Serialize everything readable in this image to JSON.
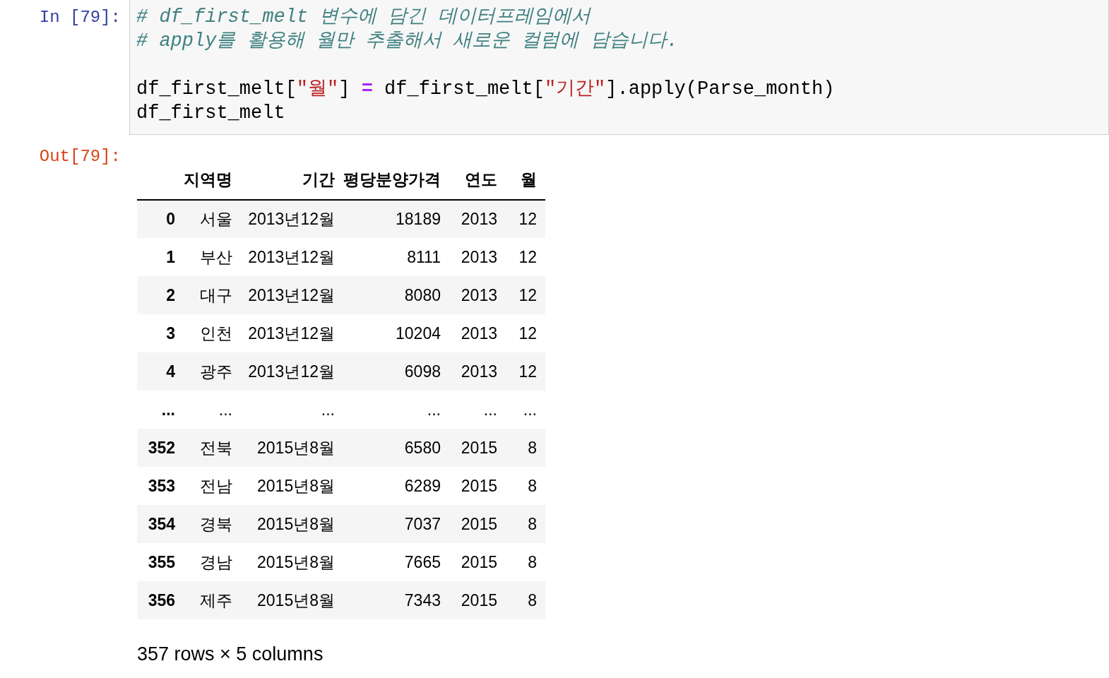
{
  "input_cell": {
    "prompt": "In [79]:",
    "lines": [
      {
        "blank_before": false,
        "tokens": [
          {
            "kind": "comment",
            "text": "# df_first_melt 변수에 담긴 데이터프레임에서"
          }
        ]
      },
      {
        "blank_before": false,
        "tokens": [
          {
            "kind": "comment",
            "text": "# apply를 활용해 월만 추출해서 새로운 컬럼에 담습니다."
          }
        ]
      },
      {
        "blank_before": true,
        "tokens": [
          {
            "kind": "plain",
            "text": "df_first_melt["
          },
          {
            "kind": "string",
            "text": "\"월\""
          },
          {
            "kind": "plain",
            "text": "] "
          },
          {
            "kind": "operator",
            "text": "="
          },
          {
            "kind": "plain",
            "text": " df_first_melt["
          },
          {
            "kind": "string",
            "text": "\"기간\""
          },
          {
            "kind": "plain",
            "text": "].apply(Parse_month)"
          }
        ]
      },
      {
        "blank_before": false,
        "tokens": [
          {
            "kind": "plain",
            "text": "df_first_melt"
          }
        ]
      }
    ]
  },
  "output_cell": {
    "prompt": "Out[79]:",
    "table": {
      "columns": [
        "지역명",
        "기간",
        "평당분양가격",
        "연도",
        "월"
      ],
      "rows": [
        {
          "index": "0",
          "cells": [
            "서울",
            "2013년12월",
            "18189",
            "2013",
            "12"
          ]
        },
        {
          "index": "1",
          "cells": [
            "부산",
            "2013년12월",
            "8111",
            "2013",
            "12"
          ]
        },
        {
          "index": "2",
          "cells": [
            "대구",
            "2013년12월",
            "8080",
            "2013",
            "12"
          ]
        },
        {
          "index": "3",
          "cells": [
            "인천",
            "2013년12월",
            "10204",
            "2013",
            "12"
          ]
        },
        {
          "index": "4",
          "cells": [
            "광주",
            "2013년12월",
            "6098",
            "2013",
            "12"
          ]
        },
        {
          "index": "...",
          "cells": [
            "...",
            "...",
            "...",
            "...",
            "..."
          ]
        },
        {
          "index": "352",
          "cells": [
            "전북",
            "2015년8월",
            "6580",
            "2015",
            "8"
          ]
        },
        {
          "index": "353",
          "cells": [
            "전남",
            "2015년8월",
            "6289",
            "2015",
            "8"
          ]
        },
        {
          "index": "354",
          "cells": [
            "경북",
            "2015년8월",
            "7037",
            "2015",
            "8"
          ]
        },
        {
          "index": "355",
          "cells": [
            "경남",
            "2015년8월",
            "7665",
            "2015",
            "8"
          ]
        },
        {
          "index": "356",
          "cells": [
            "제주",
            "2015년8월",
            "7343",
            "2015",
            "8"
          ]
        }
      ]
    },
    "summary": "357 rows × 5 columns"
  }
}
